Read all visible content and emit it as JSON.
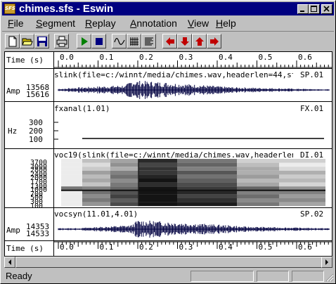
{
  "window": {
    "app_icon_text": "SFS",
    "title": "chimes.sfs - Eswin",
    "controls": [
      "minimize",
      "maximize",
      "close"
    ]
  },
  "menu": [
    {
      "label": "File",
      "underline": "F",
      "rest": "ile"
    },
    {
      "label": "Segment",
      "underline": "S",
      "rest": "egment"
    },
    {
      "label": "Replay",
      "underline": "R",
      "rest": "eplay"
    },
    {
      "label": "Annotation",
      "underline": "A",
      "rest": "nnotation"
    },
    {
      "label": "View",
      "underline": "V",
      "rest": "iew"
    },
    {
      "label": "Help",
      "underline": "H",
      "rest": "elp"
    }
  ],
  "toolbar": {
    "icons": [
      "new-icon",
      "open-icon",
      "save-icon",
      "print-icon",
      "play-icon",
      "stop-icon",
      "waveform-view-icon",
      "spectrogram-view-icon",
      "spectrum-view-icon",
      "arrow-left-icon",
      "arrow-down-icon",
      "arrow-up-icon",
      "arrow-right-icon"
    ],
    "colors": {
      "play": "#008000",
      "stop": "#000080",
      "arrows": "#c00000"
    }
  },
  "time_axis": {
    "label": "Time (s)",
    "ticks": [
      "0.0",
      "0.1",
      "0.2",
      "0.3",
      "0.4",
      "0.5",
      "0.6"
    ]
  },
  "panels": {
    "waveform1": {
      "header": "slink(file=c:/winnt/media/chimes.wav,headerlen=44,st",
      "id": "SP.01",
      "y_label": "Amp",
      "y_max": "13568",
      "y_min": "15616"
    },
    "fx": {
      "header": "fxanal(1.01)",
      "id": "FX.01",
      "y_label": "Hz",
      "ticks": [
        "300",
        "200",
        "100"
      ]
    },
    "spectrogram": {
      "header": "voc19(slink(file=c:/winnt/media/chimes.wav,headerlen=44",
      "id": "DI.01",
      "ticks": [
        "3700",
        "3000",
        "2800",
        "2400",
        "2000",
        "1700",
        "1300",
        "1000",
        "700",
        "500",
        "300",
        "100"
      ]
    },
    "waveform2": {
      "header": "vocsyn(11.01,4.01)",
      "id": "SP.02",
      "y_label": "Amp",
      "y_max": "14353",
      "y_min": "14533"
    }
  },
  "status": {
    "text": "Ready"
  }
}
